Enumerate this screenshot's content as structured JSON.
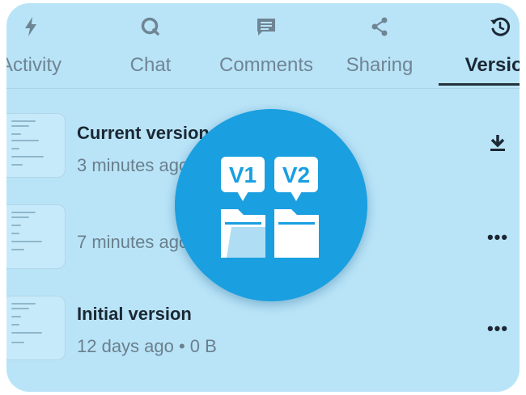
{
  "tabs": [
    {
      "label": "Activity",
      "icon": "lightning-icon",
      "active": false
    },
    {
      "label": "Chat",
      "icon": "chat-icon",
      "active": false
    },
    {
      "label": "Comments",
      "icon": "comment-icon",
      "active": false
    },
    {
      "label": "Sharing",
      "icon": "share-icon",
      "active": false
    },
    {
      "label": "Version",
      "icon": "history-icon",
      "active": true
    }
  ],
  "versions": [
    {
      "title": "Current version",
      "meta": "3 minutes ago",
      "action": "download-icon"
    },
    {
      "title": "",
      "meta": "7 minutes ago",
      "action": "more-icon"
    },
    {
      "title": "Initial version",
      "meta": "12 days ago  •  0 B",
      "action": "more-icon"
    }
  ],
  "overlay": {
    "label_v1": "V1",
    "label_v2": "V2"
  },
  "colors": {
    "card_bg": "#b9e4f8",
    "badge": "#1a9fe0",
    "text_dark": "#1b2833",
    "text_muted": "#6a7f8c"
  }
}
